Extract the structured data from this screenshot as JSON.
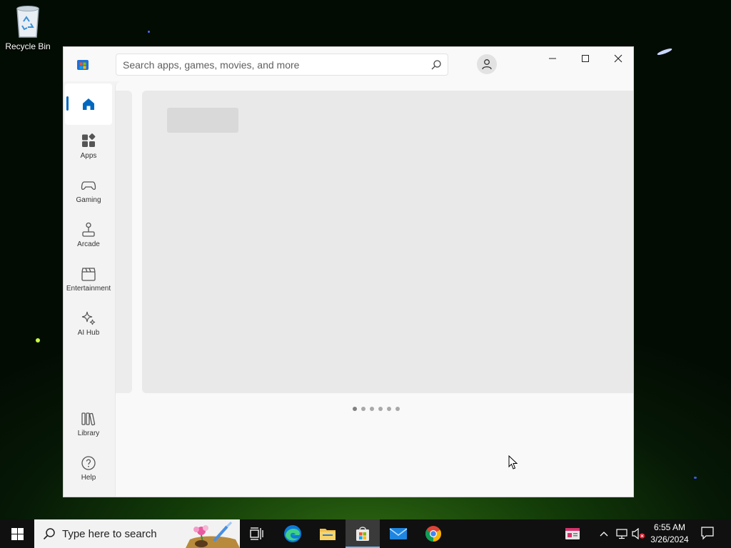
{
  "desktop": {
    "recycle_bin_label": "Recycle Bin"
  },
  "window": {
    "search": {
      "placeholder": "Search apps, games, movies, and more"
    },
    "controls": {
      "minimize": "minimize",
      "maximize": "maximize",
      "close": "close"
    }
  },
  "sidebar": {
    "items": [
      {
        "label": "",
        "icon": "home-icon",
        "active": true
      },
      {
        "label": "Apps",
        "icon": "apps-icon"
      },
      {
        "label": "Gaming",
        "icon": "gamepad-icon"
      },
      {
        "label": "Arcade",
        "icon": "joystick-icon"
      },
      {
        "label": "Entertainment",
        "icon": "clapperboard-icon"
      },
      {
        "label": "AI Hub",
        "icon": "sparkle-icon"
      }
    ],
    "bottom_items": [
      {
        "label": "Library",
        "icon": "library-icon"
      },
      {
        "label": "Help",
        "icon": "help-icon"
      }
    ]
  },
  "carousel": {
    "pages": 6,
    "current": 1
  },
  "taskbar": {
    "search_placeholder": "Type here to search",
    "pinned": [
      "task-view-icon",
      "edge-icon",
      "file-explorer-icon",
      "microsoft-store-icon",
      "mail-icon",
      "chrome-icon"
    ],
    "active": "microsoft-store-icon",
    "clock": {
      "time": "6:55 AM",
      "date": "3/26/2024"
    }
  },
  "colors": {
    "accent": "#0067c0",
    "taskbar": "#101010",
    "window_bg": "#f3f3f3"
  }
}
